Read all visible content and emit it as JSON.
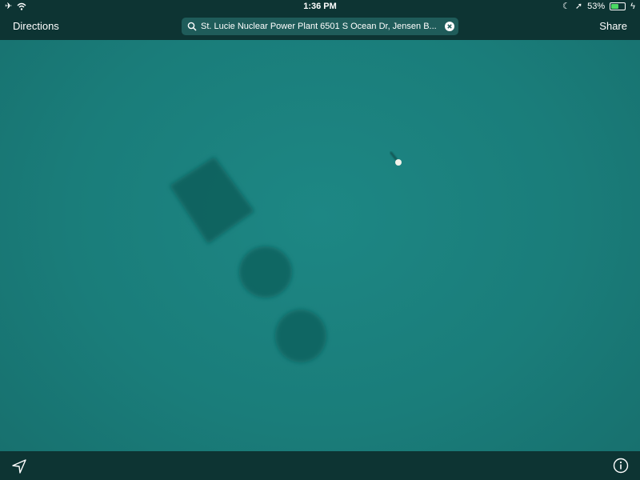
{
  "status": {
    "time": "1:36 PM",
    "battery_text": "53%",
    "battery_level": 0.53,
    "icons": [
      "airplane-icon",
      "wifi-icon",
      "moon-icon",
      "location-arrow-icon",
      "battery-icon",
      "charging-icon"
    ]
  },
  "toolbar": {
    "directions_label": "Directions",
    "share_label": "Share",
    "search": {
      "value": "St. Lucie Nuclear Power Plant 6501 S Ocean Dr, Jensen B..."
    }
  },
  "bottom": {
    "icons": [
      "location-arrow-icon",
      "info-icon"
    ]
  },
  "colors": {
    "water": "#1a7a78",
    "bars": "#0d3433",
    "search_field": "#1f5c5a",
    "battery_fill": "#4cd964"
  }
}
